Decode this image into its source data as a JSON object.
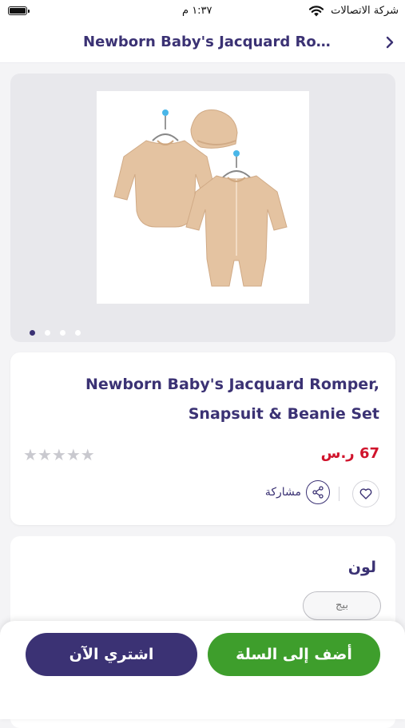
{
  "status_bar": {
    "time": "١:٣٧ م",
    "carrier": "شركة الاتصالات"
  },
  "nav": {
    "title": "Newborn Baby's Jacquard Ro...",
    "back_icon": "chevron-right-icon"
  },
  "gallery": {
    "image_description_icon": "product-image",
    "dots": [
      true,
      false,
      false,
      false
    ]
  },
  "product": {
    "title_line1": "Newborn Baby's Jacquard Romper,",
    "title_line2": "Snapsuit & Beanie Set",
    "price": "67 ر.س",
    "rating": 0,
    "rating_max": 5,
    "share_label": "مشاركة"
  },
  "color_section": {
    "heading": "لون",
    "selected_option": "بيج"
  },
  "actions": {
    "buy_now": "اشتري الآن",
    "add_to_cart": "أضف إلى السلة"
  },
  "colors": {
    "brand_purple": "#3b3274",
    "add_to_cart_green": "#3e9e2c",
    "price_red": "#d0142c",
    "star_grey": "#c9c9cf",
    "product_beige": "#e4c3a1"
  }
}
